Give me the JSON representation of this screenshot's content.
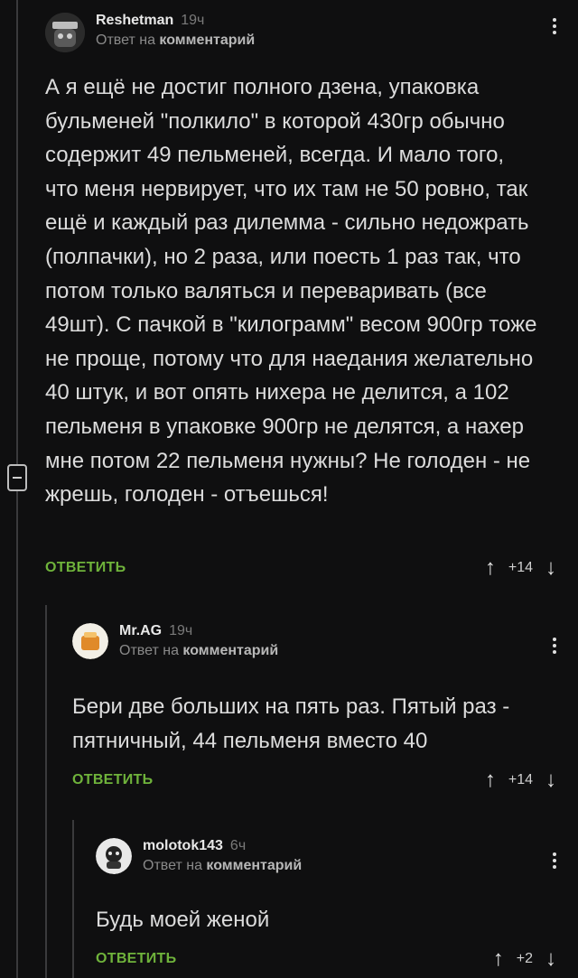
{
  "comments": [
    {
      "username": "Reshetman",
      "time": "19ч",
      "reply_prefix": "Ответ на",
      "reply_target": "комментарий",
      "text": "А я ещё не достиг полного дзена, упаковка бульменей \"полкило\" в которой 430гр обычно содержит 49 пельменей, всегда. И мало того, что меня нервирует, что их там не 50 ровно, так ещё и каждый раз дилемма - сильно недожрать (полпачки), но 2 раза, или поесть 1 раз так, что потом только валяться и переваривать (все 49шт). С пачкой в \"килограмм\" весом 900гр тоже не проще, потому что для наедания желательно 40 штук, и вот опять нихера не делится, а 102 пельменя в упаковке 900гр не делятся, а нахер мне потом 22 пельменя нужны? Не голоден - не жрешь, голоден - отъешься!",
      "reply_label": "ОТВЕТИТЬ",
      "rating": "+14",
      "avatar_colors": [
        "#3a3a3a",
        "#bfbfbf"
      ]
    },
    {
      "username": "Mr.AG",
      "time": "19ч",
      "reply_prefix": "Ответ на",
      "reply_target": "комментарий",
      "text": "Бери две больших на пять раз. Пятый раз - пятничный, 44 пельменя вместо 40",
      "reply_label": "ОТВЕТИТЬ",
      "rating": "+14",
      "avatar_colors": [
        "#f2efe6",
        "#e08a2a"
      ]
    },
    {
      "username": "molotok143",
      "time": "6ч",
      "reply_prefix": "Ответ на",
      "reply_target": "комментарий",
      "text": "Будь моей женой",
      "reply_label": "ОТВЕТИТЬ",
      "rating": "+2",
      "avatar_colors": [
        "#e8e8e8",
        "#222222"
      ]
    }
  ],
  "icons": {
    "upvote": "arrow-up-icon",
    "downvote": "arrow-down-icon",
    "menu": "more-vertical-icon",
    "collapse": "collapse-thread-icon"
  },
  "accent_color": "#6fb33b"
}
